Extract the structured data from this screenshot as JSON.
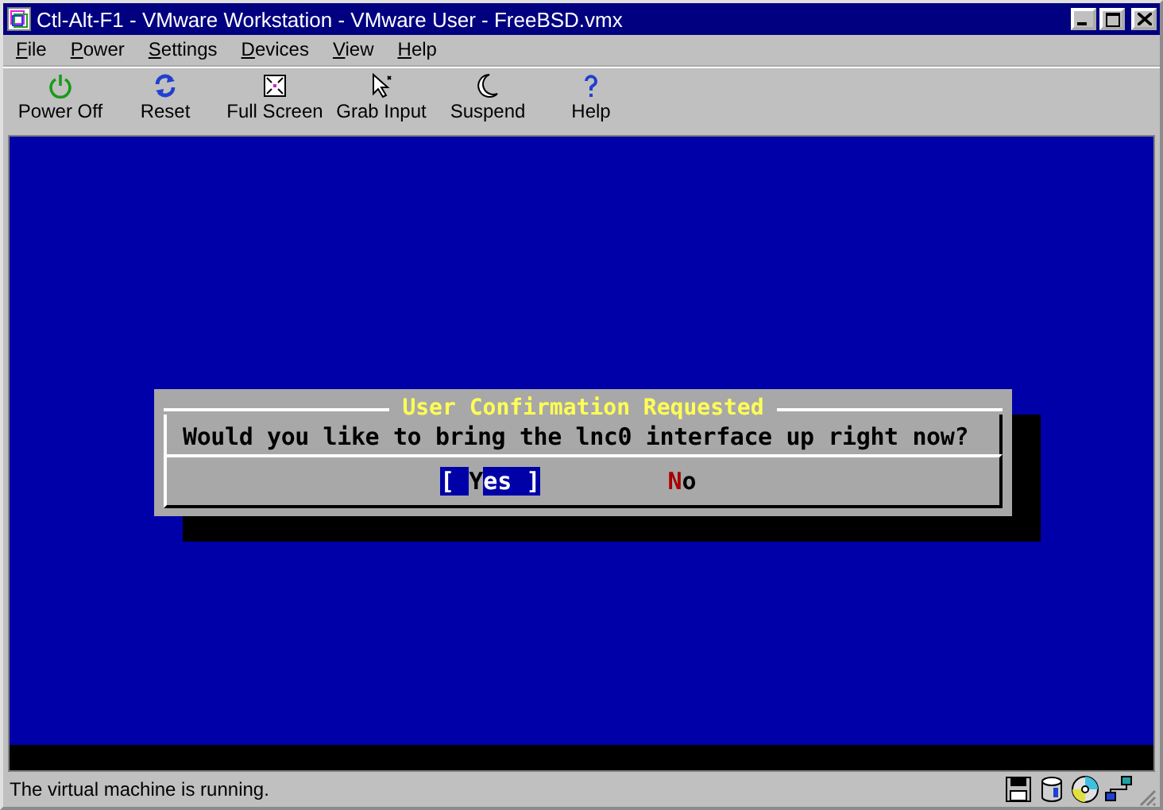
{
  "window": {
    "title": "Ctl-Alt-F1 - VMware Workstation - VMware User - FreeBSD.vmx"
  },
  "menu": [
    {
      "label": "File"
    },
    {
      "label": "Power"
    },
    {
      "label": "Settings"
    },
    {
      "label": "Devices"
    },
    {
      "label": "View"
    },
    {
      "label": "Help"
    }
  ],
  "toolbar": [
    {
      "kind": "power",
      "label": "Power Off"
    },
    {
      "kind": "reset",
      "label": "Reset"
    },
    {
      "kind": "fullscreen",
      "label": "Full Screen"
    },
    {
      "kind": "grab",
      "label": "Grab Input"
    },
    {
      "kind": "suspend",
      "label": "Suspend"
    },
    {
      "kind": "help",
      "label": "Help"
    }
  ],
  "dialog": {
    "title": "User Confirmation Requested",
    "message": "Would you like to bring the lnc0 interface up right now?",
    "buttons": [
      {
        "label": "[ Yes ]",
        "selected": true
      },
      {
        "label": "No",
        "selected": false
      }
    ]
  },
  "status_bar": {
    "text": "The virtual machine is running.",
    "devices": [
      {
        "kind": "floppy"
      },
      {
        "kind": "disk"
      },
      {
        "kind": "cdrom"
      },
      {
        "kind": "network"
      }
    ]
  }
}
